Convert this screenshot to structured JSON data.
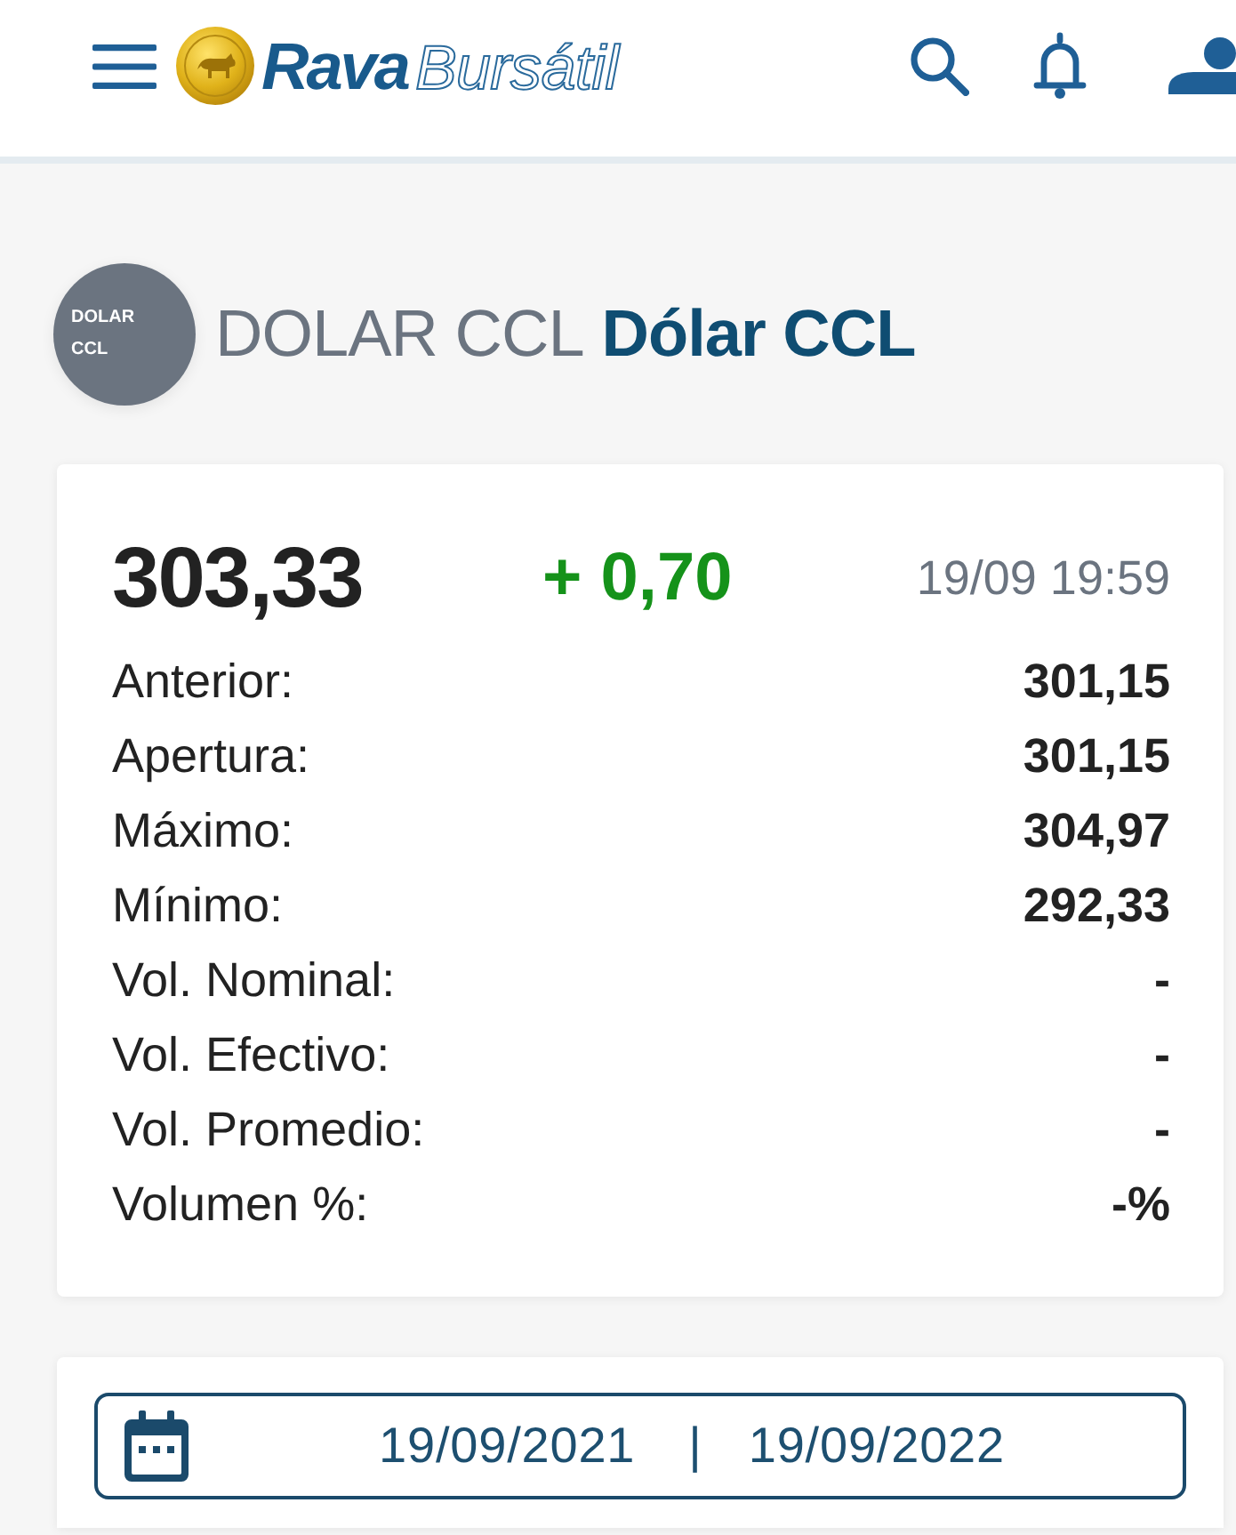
{
  "header": {
    "logo": {
      "word": "Rava",
      "word_outline": "Bursátil"
    }
  },
  "instrument": {
    "badge": "DOLAR CCL",
    "symbol": "DOLAR CCL",
    "name": "Dólar CCL"
  },
  "quote": {
    "price": "303,33",
    "change": "+ 0,70",
    "rising": true,
    "timestamp": "19/09 19:59",
    "stats": [
      {
        "label": "Anterior:",
        "value": "301,15"
      },
      {
        "label": "Apertura:",
        "value": "301,15"
      },
      {
        "label": "Máximo:",
        "value": "304,97"
      },
      {
        "label": "Mínimo:",
        "value": "292,33"
      },
      {
        "label": "Vol. Nominal:",
        "value": "-"
      },
      {
        "label": "Vol. Efectivo:",
        "value": "-"
      },
      {
        "label": "Vol. Promedio:",
        "value": "-"
      },
      {
        "label": "Volumen %:",
        "value": "-%"
      }
    ]
  },
  "date_range": {
    "from": "19/09/2021",
    "separator": "|",
    "to": "19/09/2022"
  }
}
